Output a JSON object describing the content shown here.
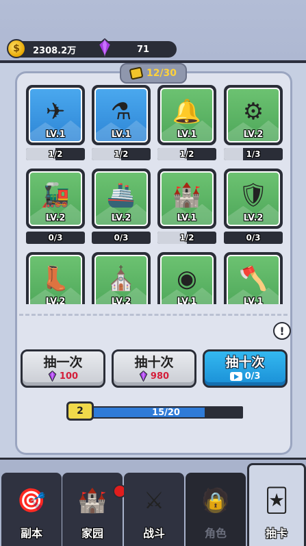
{
  "resources": {
    "coins": "2308.2万",
    "gems": "71"
  },
  "card_count": "12/30",
  "cards": [
    {
      "name": "airplane",
      "art": "✈",
      "level": "LV.1",
      "progress": "1/2",
      "fill": 0.5,
      "bg": "blue"
    },
    {
      "name": "potion-flasks",
      "art": "⚗",
      "level": "LV.1",
      "progress": "1/2",
      "fill": 0.5,
      "bg": "blue"
    },
    {
      "name": "lamp",
      "art": "🔔",
      "level": "LV.1",
      "progress": "1/2",
      "fill": 0.5,
      "bg": "green"
    },
    {
      "name": "steam-engine",
      "art": "⚙",
      "level": "LV.2",
      "progress": "1/3",
      "fill": 0.33,
      "bg": "green"
    },
    {
      "name": "locomotive",
      "art": "🚂",
      "level": "LV.2",
      "progress": "0/3",
      "fill": 0,
      "bg": "green"
    },
    {
      "name": "steamship",
      "art": "🚢",
      "level": "LV.2",
      "progress": "0/3",
      "fill": 0,
      "bg": "green"
    },
    {
      "name": "castle",
      "art": "🏰",
      "level": "LV.1",
      "progress": "1/2",
      "fill": 0.5,
      "bg": "green"
    },
    {
      "name": "armor",
      "art": "🛡",
      "level": "LV.2",
      "progress": "0/3",
      "fill": 0,
      "bg": "green"
    },
    {
      "name": "boot",
      "art": "👢",
      "level": "LV.2",
      "progress": "",
      "fill": 0,
      "bg": "green"
    },
    {
      "name": "church",
      "art": "⛪",
      "level": "LV.2",
      "progress": "",
      "fill": 0,
      "bg": "green"
    },
    {
      "name": "round-shield",
      "art": "◉",
      "level": "LV.1",
      "progress": "",
      "fill": 0,
      "bg": "green"
    },
    {
      "name": "axe",
      "art": "🪓",
      "level": "LV.1",
      "progress": "",
      "fill": 0,
      "bg": "green"
    }
  ],
  "draw_buttons": [
    {
      "title": "抽一次",
      "cost": "100",
      "kind": "gem",
      "style": "grey"
    },
    {
      "title": "抽十次",
      "cost": "980",
      "kind": "gem",
      "style": "grey"
    },
    {
      "title": "抽十次",
      "cost": "0/3",
      "kind": "video",
      "style": "blue"
    }
  ],
  "level": {
    "value": "2",
    "xp_text": "15/20",
    "fraction": 0.75
  },
  "nav": [
    {
      "label": "副本",
      "icon": "target-icon",
      "glyph": "🎯",
      "state": "normal"
    },
    {
      "label": "家园",
      "icon": "castle-icon",
      "glyph": "🏰",
      "state": "normal",
      "badge": true
    },
    {
      "label": "战斗",
      "icon": "swords-icon",
      "glyph": "⚔",
      "state": "normal"
    },
    {
      "label": "角色",
      "icon": "character-icon",
      "glyph": "🧑",
      "state": "locked"
    },
    {
      "label": "抽卡",
      "icon": "card-draw-icon",
      "glyph": "🃏",
      "state": "active"
    }
  ],
  "colors": {
    "accent_blue": "#1a8fd6",
    "gem_pink": "#d41e3a",
    "gold": "#f2c52a"
  }
}
